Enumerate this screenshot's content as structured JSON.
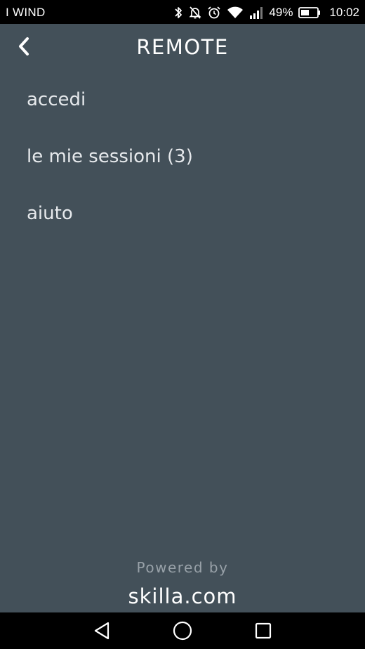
{
  "status_bar": {
    "carrier": "I WIND",
    "battery_percent": "49%",
    "time": "10:02",
    "icons": [
      "bluetooth-icon",
      "vibrate-muted-icon",
      "alarm-icon",
      "wifi-icon",
      "signal-icon",
      "battery-icon"
    ]
  },
  "header": {
    "title": "REMOTE",
    "back_icon": "chevron-left-icon"
  },
  "menu": {
    "items": [
      {
        "label": "accedi"
      },
      {
        "label": "le mie sessioni (3)"
      },
      {
        "label": "aiuto"
      }
    ]
  },
  "footer": {
    "powered_by": "Powered by",
    "brand": "skilla.com"
  },
  "nav_bar": {
    "icons": [
      "back-triangle-icon",
      "home-circle-icon",
      "recents-square-icon"
    ]
  },
  "colors": {
    "background": "#435059",
    "system_bar": "#000000",
    "text_primary": "#ffffff",
    "text_menu": "#e6e9ec",
    "text_muted": "#98a1a8"
  }
}
